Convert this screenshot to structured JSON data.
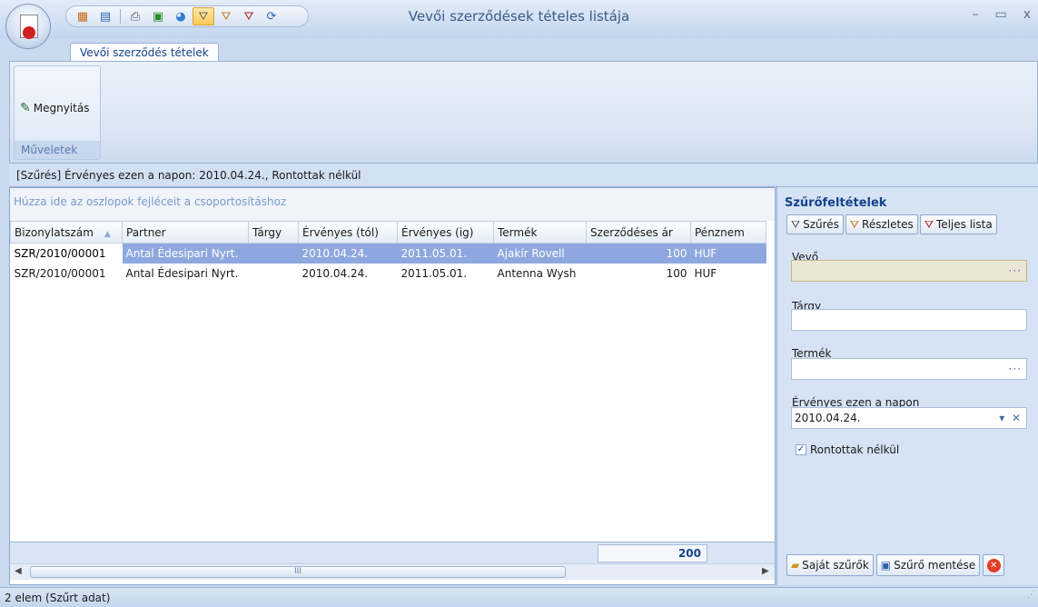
{
  "window": {
    "title": "Vevői szerződések tételes listája",
    "minimize": "–",
    "maximize": "▭",
    "close": "x"
  },
  "ribbon": {
    "tab_label": "Vevői szerződés tételek",
    "open_button_label": "Megnyitás",
    "group_label": "Műveletek"
  },
  "filter_status": "[Szűrés]  Érvényes ezen a napon: 2010.04.24., Rontottak nélkül",
  "grid": {
    "group_hint": "Húzza ide az oszlopok fejléceit a csoportosításhoz",
    "columns": [
      "Bizonylatszám",
      "Partner",
      "Tárgy",
      "Érvényes (tól)",
      "Érvényes (ig)",
      "Termék",
      "Szerződéses ár",
      "Pénznem"
    ],
    "rows": [
      {
        "doc": "SZR/2010/00001",
        "partner": "Antal Édesipari Nyrt.",
        "subject": "",
        "valid_from": "2010.04.24.",
        "valid_to": "2011.05.01.",
        "product": "Ajakír Rovell",
        "price": "100",
        "currency": "HUF"
      },
      {
        "doc": "SZR/2010/00001",
        "partner": "Antal Édesipari Nyrt.",
        "subject": "",
        "valid_from": "2010.04.24.",
        "valid_to": "2011.05.01.",
        "product": "Antenna Wysh",
        "price": "100",
        "currency": "HUF"
      }
    ],
    "sum_price": "200",
    "scroll_thumb": "III"
  },
  "filter_panel": {
    "title": "Szűrőfeltételek",
    "btn_filter": "Szűrés",
    "btn_detailed": "Részletes",
    "btn_full_list": "Teljes lista",
    "customer_label": "Vevő",
    "customer_value": "",
    "subject_label": "Tárgy",
    "subject_value": "",
    "product_label": "Termék",
    "product_value": "",
    "date_label": "Érvényes ezen a napon",
    "date_value": "2010.04.24.",
    "exclude_voided_label": "Rontottak nélkül",
    "exclude_voided_checked": true,
    "btn_own_filters": "Saját szűrők",
    "btn_save_filter": "Szűrő mentése"
  },
  "status": "2 elem (Szűrt adat)"
}
